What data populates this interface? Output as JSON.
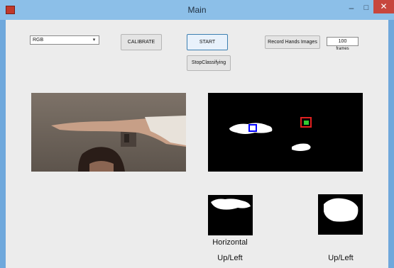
{
  "window": {
    "title": "Main",
    "minimize_glyph": "–",
    "maximize_glyph": "□",
    "close_glyph": "✕"
  },
  "controls": {
    "color_space": {
      "selected": "RGB"
    },
    "calibrate_label": "CALIBRATE",
    "start_label": "START",
    "stop_label": "StopClassifying",
    "record_label": "Record Hands Images",
    "frames_value": "100",
    "frames_label": "frames"
  },
  "results": {
    "left_orientation": "Horizontal",
    "left_direction": "Up/Left",
    "right_direction": "Up/Left"
  },
  "colors": {
    "accent_blue": "#0000ff",
    "accent_red": "#e02020",
    "accent_green": "#33cc33",
    "titlebar": "#8cbfe8",
    "client_bg": "#ececec"
  },
  "icons": {
    "app": "matlab-icon",
    "dropdown": "chevron-down-icon"
  }
}
